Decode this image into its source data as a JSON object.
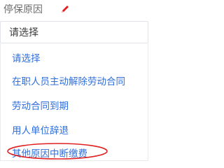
{
  "field": {
    "label": "停保原因",
    "edit_icon": "pencil-icon"
  },
  "select": {
    "value": "请选择"
  },
  "options": [
    {
      "label": "请选择"
    },
    {
      "label": "在职人员主动解除劳动合同"
    },
    {
      "label": "劳动合同到期"
    },
    {
      "label": "用人单位辞退"
    },
    {
      "label": "其他原因中断缴费"
    }
  ],
  "colors": {
    "label_text": "#6d6d6d",
    "option_text": "#2f6fdc",
    "pencil": "#e02020",
    "annotation": "#e02020"
  }
}
